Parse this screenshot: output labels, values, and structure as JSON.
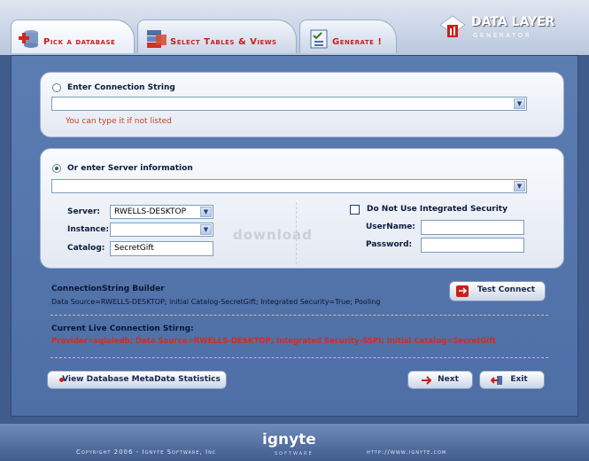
{
  "tabs": [
    {
      "label": "Pick a database",
      "icon": "plus-database-icon"
    },
    {
      "label": "Select Tables & Views",
      "icon": "tables-icon"
    },
    {
      "label": "Generate !",
      "icon": "checklist-icon"
    }
  ],
  "logo": {
    "title": "DATA LAYER",
    "subtitle": "GENERATOR"
  },
  "connection_string": {
    "radio_label": "Enter Connection String",
    "value": "",
    "hint": "You can type it if not listed"
  },
  "server_info": {
    "radio_label": "Or enter Server information",
    "combo_value": "",
    "server_label": "Server:",
    "server_value": "RWELLS-DESKTOP",
    "instance_label": "Instance:",
    "instance_value": "",
    "catalog_label": "Catalog:",
    "catalog_value": "SecretGift",
    "integrated_security_label": "Do Not Use Integrated Security",
    "username_label": "UserName:",
    "username_value": "",
    "password_label": "Password:",
    "password_value": ""
  },
  "watermark": "download",
  "builder": {
    "title": "ConnectionString Builder",
    "text": "Data Source=RWELLS-DESKTOP; initial Catalog-SecretGift; Integrated Security=True; Pooling",
    "test_button": "Test Connect"
  },
  "live": {
    "title": "Current Live Connection Stirng:",
    "text": "Provider=sqloledb; Data Source=RWELLS-DESKTOP; Integrated Security-SSPI; Initial Catalog=SecretGift"
  },
  "buttons": {
    "metadata": "View Database MetaData Statistics",
    "next": "Next",
    "exit": "Exit"
  },
  "footer": {
    "copyright": "Copyright 2006 - Ignyte Software, Inc",
    "brand": "ignyte",
    "brand_sub": "SOFTWARE",
    "url": "http://www.ignyte.com"
  },
  "colors": {
    "accent_red": "#c8201a",
    "panel_bg": "#eef2f8",
    "content_bg": "#557ab0"
  }
}
